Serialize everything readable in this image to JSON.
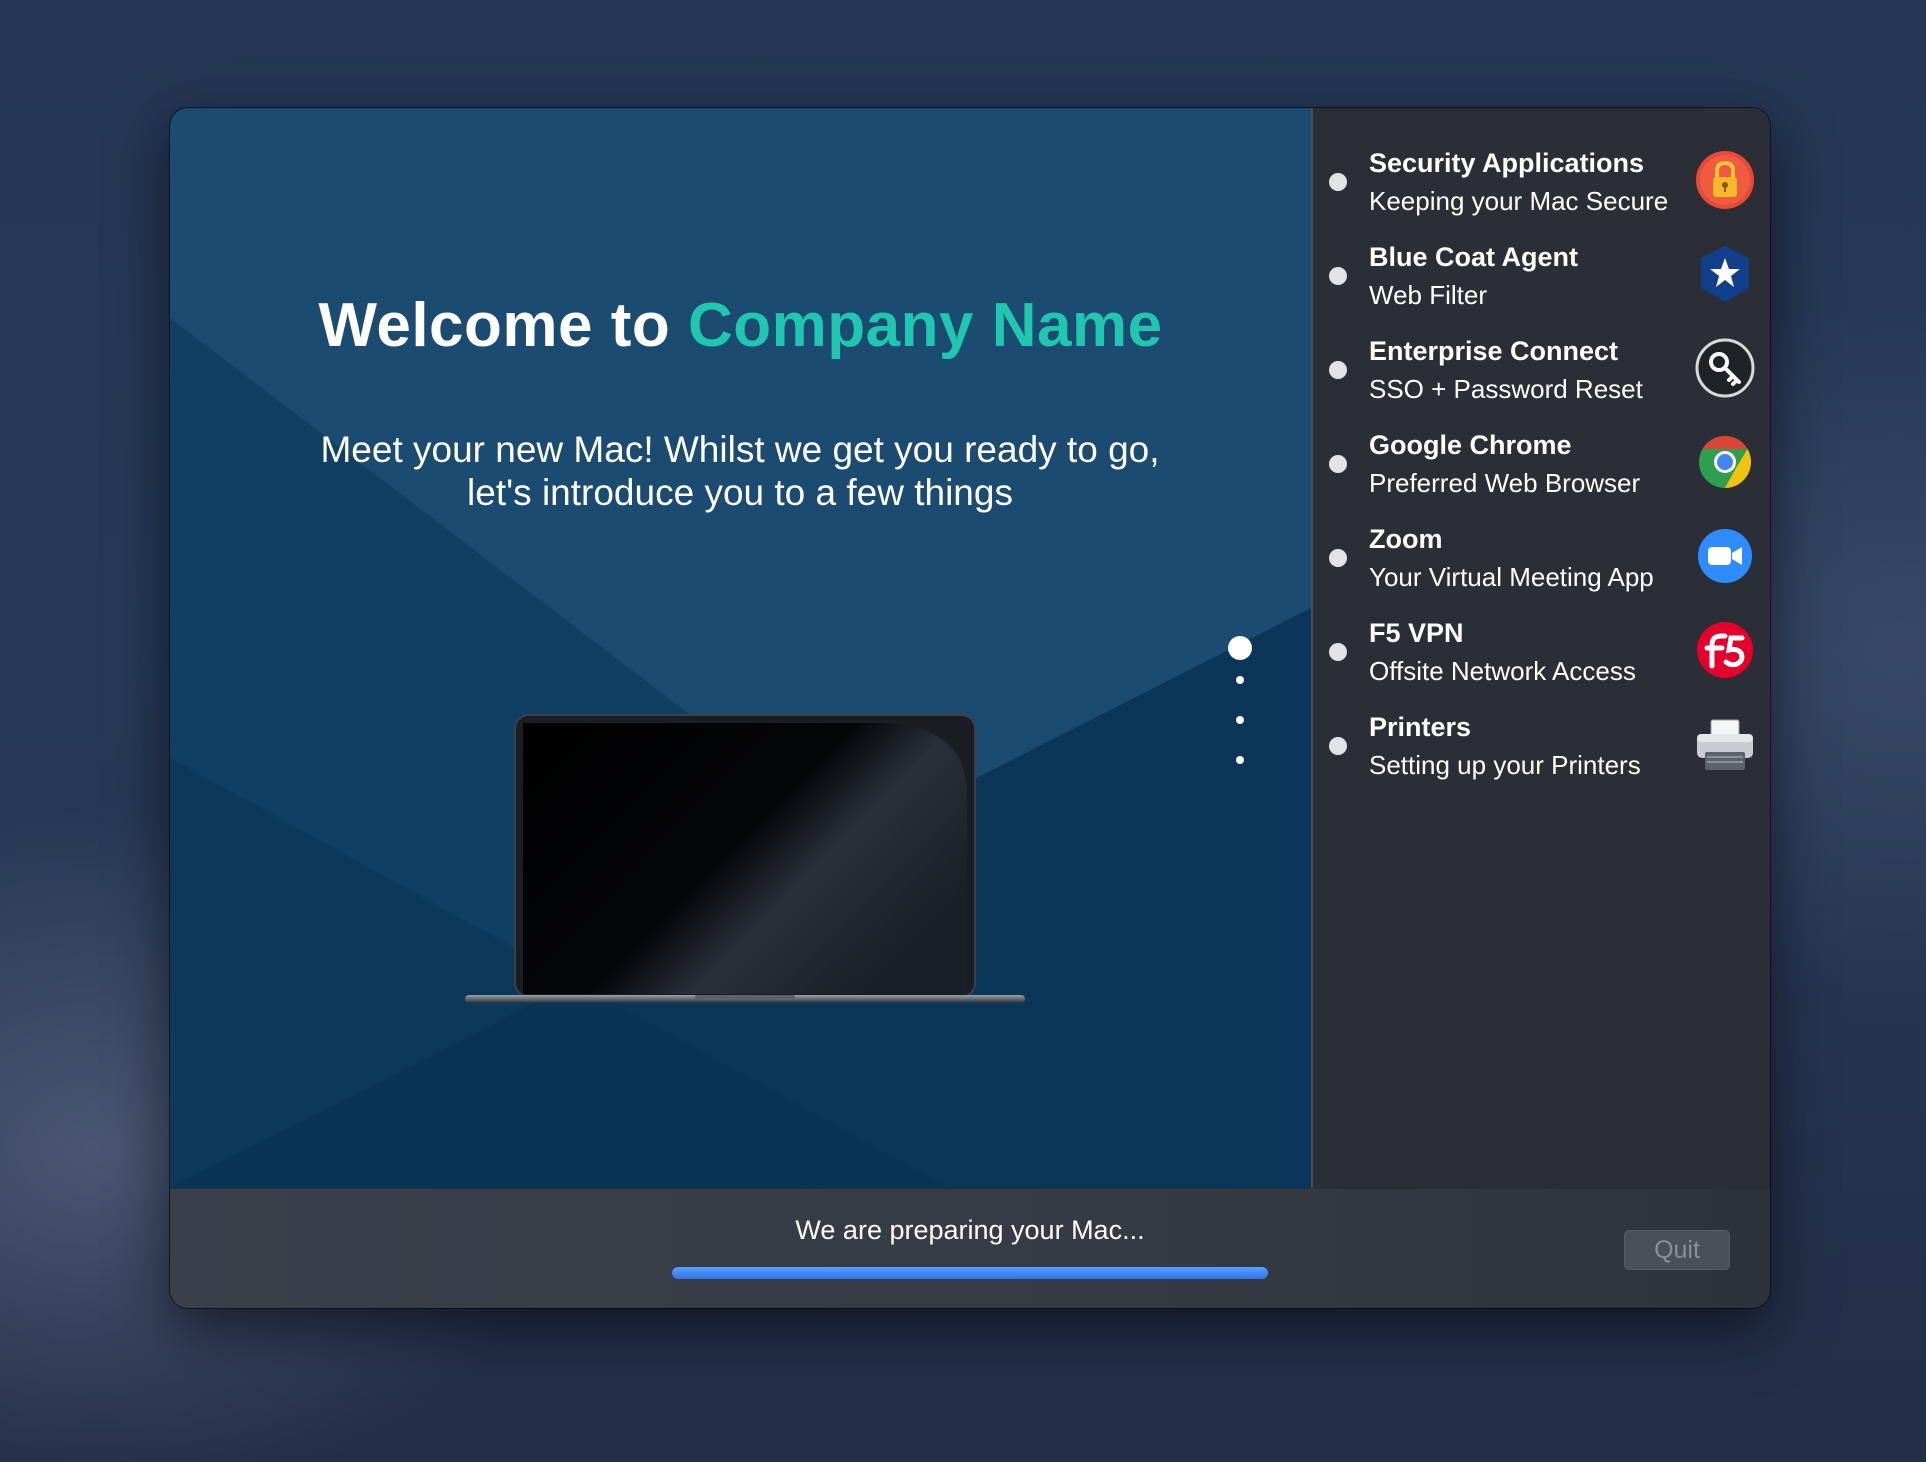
{
  "welcome": {
    "prefix": "Welcome to",
    "company": "Company Name",
    "line1": "Meet your new Mac! Whilst we get you ready to go,",
    "line2": "let's introduce you to a few things"
  },
  "carousel": {
    "total_pages": 4,
    "current_page": 1
  },
  "install_list": [
    {
      "title": "Security Applications",
      "subtitle": "Keeping your Mac Secure",
      "icon": "lock-icon"
    },
    {
      "title": "Blue Coat Agent",
      "subtitle": "Web Filter",
      "icon": "star-shield-icon"
    },
    {
      "title": "Enterprise Connect",
      "subtitle": "SSO + Password Reset",
      "icon": "key-icon"
    },
    {
      "title": "Google Chrome",
      "subtitle": "Preferred Web Browser",
      "icon": "chrome-icon"
    },
    {
      "title": "Zoom",
      "subtitle": "Your Virtual Meeting App",
      "icon": "zoom-camera-icon"
    },
    {
      "title": "F5 VPN",
      "subtitle": "Offsite Network Access",
      "icon": "f5-logo-icon"
    },
    {
      "title": "Printers",
      "subtitle": "Setting up your Printers",
      "icon": "printer-icon"
    }
  ],
  "footer": {
    "status_text": "We are preparing your Mac...",
    "progress": 1.0,
    "quit_label": "Quit"
  },
  "colors": {
    "accent": "#1fc7b0",
    "progress": "#3d82f0"
  }
}
